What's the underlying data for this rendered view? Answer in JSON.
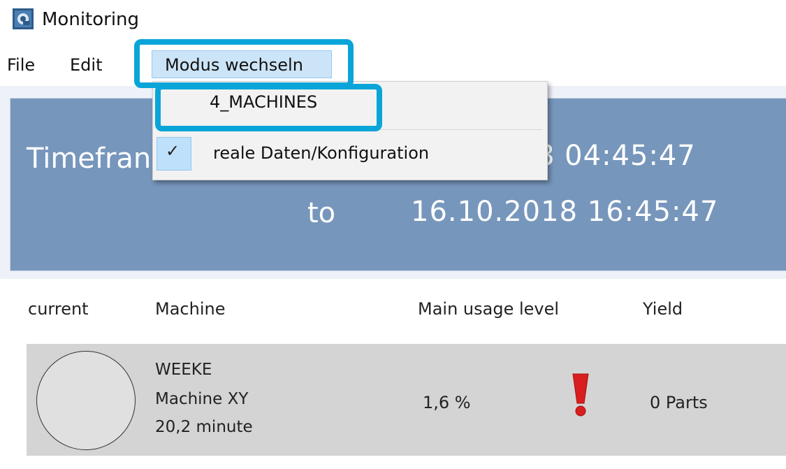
{
  "window": {
    "title": "Monitoring",
    "icon": "monitoring-app-icon"
  },
  "menubar": {
    "file": "File",
    "edit": "Edit",
    "modus": "Modus wechseln"
  },
  "dropdown": {
    "items": [
      {
        "label": "4_MACHINES",
        "checked": false
      },
      {
        "label": "reale Daten/Konfiguration",
        "checked": true
      }
    ],
    "check_glyph": "✓"
  },
  "timeframe": {
    "label": "Timefran",
    "from_visible": "8 04:45:47",
    "to_label": "to",
    "to": "16.10.2018 16:45:47"
  },
  "table": {
    "headers": [
      "current",
      "Machine",
      "Main usage level",
      "Yield"
    ],
    "rows": [
      {
        "machine": [
          "WEEKE",
          "Machine XY",
          "20,2 minute"
        ],
        "usage": "1,6 %",
        "alert_icon": "exclamation-icon",
        "yield": "0 Parts"
      }
    ]
  },
  "colors": {
    "panel": "#7796bc",
    "highlight": "#0aa5d8",
    "alert": "#d81e1e",
    "row": "#d4d4d4"
  }
}
